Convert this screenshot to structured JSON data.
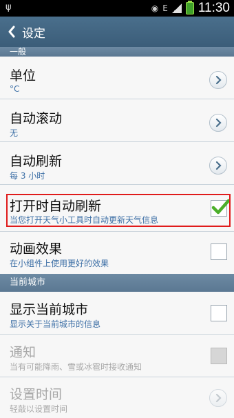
{
  "status_bar": {
    "time": "11:30",
    "carrier_icon": "E"
  },
  "action_bar": {
    "title": "设定"
  },
  "sections": {
    "general": "一般",
    "current_city": "当前城市"
  },
  "items": [
    {
      "title": "单位",
      "subtitle": "°C",
      "control": "chevron",
      "enabled": true
    },
    {
      "title": "自动滚动",
      "subtitle": "无",
      "control": "chevron",
      "enabled": true
    },
    {
      "title": "自动刷新",
      "subtitle": "每 3 小时",
      "control": "chevron",
      "enabled": true
    },
    {
      "title": "打开时自动刷新",
      "subtitle": "当您打开天气小工具时自动更新天气信息",
      "control": "checkbox",
      "checked": true,
      "enabled": true,
      "highlighted": true
    },
    {
      "title": "动画效果",
      "subtitle": "在小组件上使用更好的效果",
      "control": "checkbox",
      "checked": false,
      "enabled": true
    },
    {
      "title": "显示当前城市",
      "subtitle": "显示关于当前城市的信息",
      "control": "checkbox",
      "checked": false,
      "enabled": true
    },
    {
      "title": "通知",
      "subtitle": "当有可能降雨、雪或冰雹时接收通知",
      "control": "checkbox",
      "checked": false,
      "enabled": false
    },
    {
      "title": "设置时间",
      "subtitle": "轻敲以设置时间",
      "control": "chevron",
      "enabled": false
    }
  ],
  "colors": {
    "action_bar": "#3b5d79",
    "section_header": "#5b7892",
    "subtitle": "#3b6ea5",
    "highlight": "#e01b1b",
    "check": "#4caf2a"
  }
}
